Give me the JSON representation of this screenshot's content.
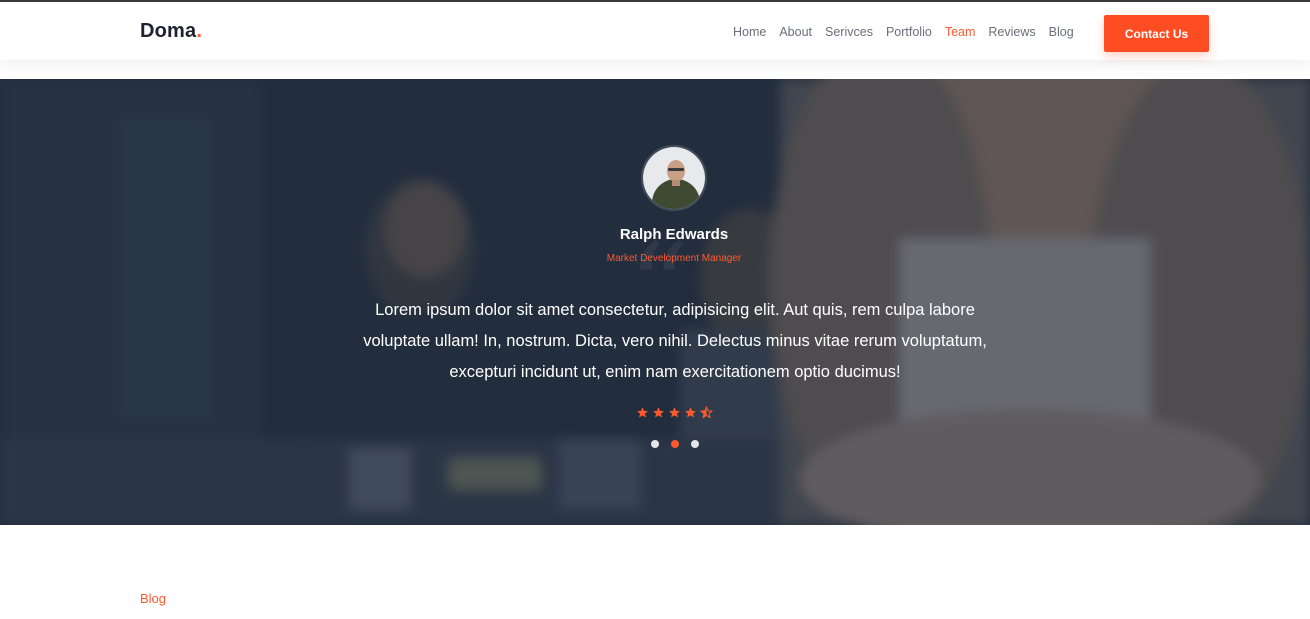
{
  "header": {
    "logo": "Doma",
    "logo_dot": ".",
    "nav": [
      {
        "label": "Home",
        "active": false
      },
      {
        "label": "About",
        "active": false
      },
      {
        "label": "Serivces",
        "active": false
      },
      {
        "label": "Portfolio",
        "active": false
      },
      {
        "label": "Team",
        "active": true
      },
      {
        "label": "Reviews",
        "active": false
      },
      {
        "label": "Blog",
        "active": false
      }
    ],
    "cta_label": "Contact Us"
  },
  "testimonial": {
    "name": "Ralph Edwards",
    "role": "Market Development Manager",
    "quote": "Lorem ipsum dolor sit amet consectetur, adipisicing elit. Aut quis, rem culpa labore voluptate ullam! In, nostrum. Dicta, vero nihil. Delectus minus vitae rerum voluptatum, excepturi incidunt ut, enim nam exercitationem optio ducimus!",
    "rating": 4.5,
    "rating_max": 5,
    "slides": 3,
    "active_slide": 2
  },
  "section": {
    "label": "Blog"
  },
  "colors": {
    "accent": "#fe5a2e",
    "overlay": "#1c283a"
  }
}
